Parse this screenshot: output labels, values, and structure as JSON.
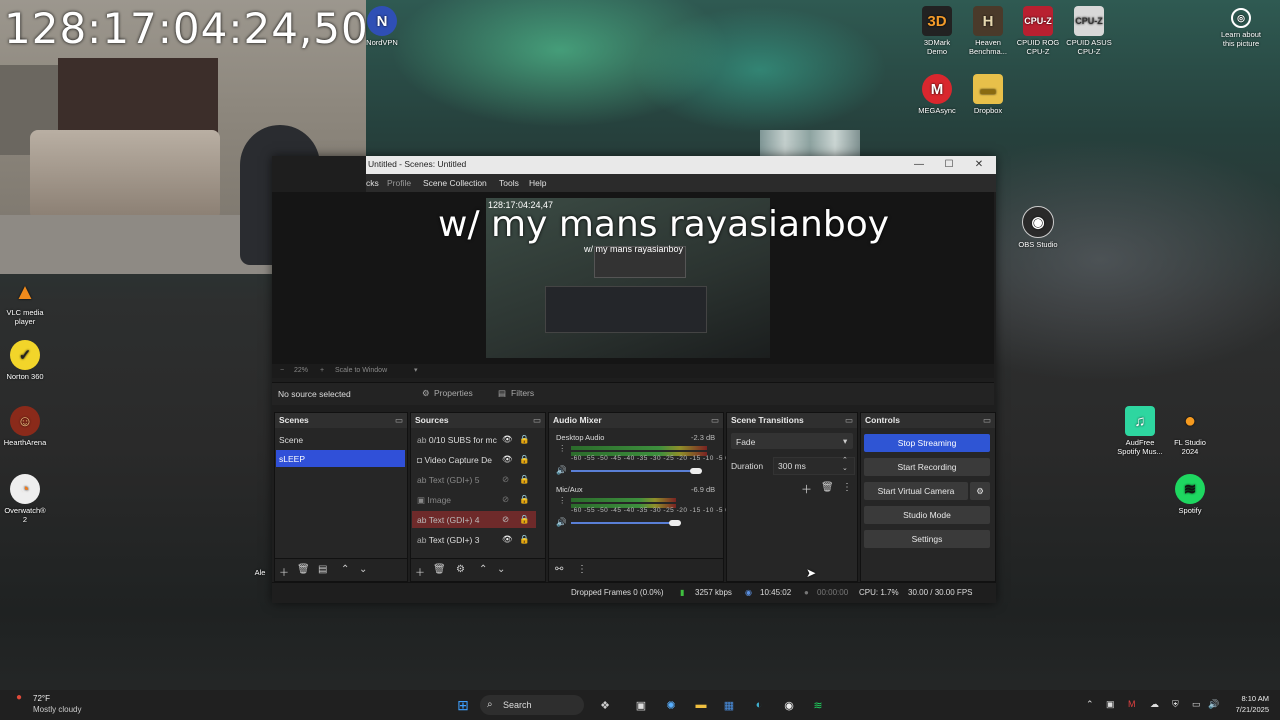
{
  "webcam": {
    "timecode": "128:17:04:24,50"
  },
  "desktop_icons": [
    {
      "label": "NordVPN"
    },
    {
      "label": "3DMark\nDemo"
    },
    {
      "label": "Heaven\nBenchma..."
    },
    {
      "label": "CPUID ROG\nCPU-Z"
    },
    {
      "label": "CPUID ASUS\nCPU-Z"
    },
    {
      "label": "Learn about\nthis picture"
    },
    {
      "label": "MEGAsync"
    },
    {
      "label": "Dropbox"
    },
    {
      "label": "OBS Studio"
    },
    {
      "label": "VLC media\nplayer"
    },
    {
      "label": "Norton 360"
    },
    {
      "label": "HearthArena"
    },
    {
      "label": "Overwatch®\n2"
    },
    {
      "label": "AudFree\nSpotify Mus..."
    },
    {
      "label": "FL Studio\n2024"
    },
    {
      "label": "Spotify"
    },
    {
      "label": "Ale"
    }
  ],
  "obs": {
    "title": "Untitled - Scenes: Untitled",
    "menu": [
      "cks",
      "Profile",
      "Scene Collection",
      "Tools",
      "Help"
    ],
    "preview": {
      "overlay_text": "w/ my mans rayasianboy",
      "inner_timecode": "128:17:04:24,47",
      "nested_title": "w/ my mans rayasianboy"
    },
    "zoom": {
      "minus": "−",
      "value": "22%",
      "plus": "+",
      "fit": "Scale to Window"
    },
    "source_toolbar": {
      "status": "No source selected",
      "properties": "Properties",
      "filters": "Filters"
    },
    "scenes": {
      "title": "Scenes",
      "items": [
        "Scene",
        "sLEEP"
      ]
    },
    "sources": {
      "title": "Sources",
      "items": [
        "0/10 SUBS for mc",
        "Video Capture De",
        "Text (GDI+) 5",
        "Image",
        "Text (GDI+) 4",
        "Text (GDI+) 3"
      ]
    },
    "mixer": {
      "title": "Audio Mixer",
      "channels": [
        {
          "name": "Desktop Audio",
          "db": "-2.3 dB",
          "scale": "-60 -55 -50 -45 -40 -35 -30 -25 -20 -15 -10 -5 0",
          "level": 0.93
        },
        {
          "name": "Mic/Aux",
          "db": "-6.9 dB",
          "scale": "-60 -55 -50 -45 -40 -35 -30 -25 -20 -15 -10 -5 0",
          "level": 0.72
        }
      ]
    },
    "transitions": {
      "title": "Scene Transitions",
      "type": "Fade",
      "duration_label": "Duration",
      "duration": "300 ms"
    },
    "controls": {
      "title": "Controls",
      "stop_streaming": "Stop Streaming",
      "start_recording": "Start Recording",
      "start_virtual_camera": "Start Virtual Camera",
      "studio_mode": "Studio Mode",
      "settings": "Settings"
    },
    "status": {
      "dropped": "Dropped Frames 0 (0.0%)",
      "kbps": "3257 kbps",
      "stream_time": "10:45:02",
      "rec_time": "00:00:00",
      "cpu": "CPU: 1.7%",
      "fps": "30.00 / 30.00 FPS"
    }
  },
  "taskbar": {
    "weather_temp": "72°F",
    "weather_desc": "Mostly cloudy",
    "search": "Search",
    "time": "8:10 AM",
    "date": "7/21/2025"
  },
  "colors": {
    "accent": "#3050d8",
    "active_source": "#6e2a2a",
    "stop_stream": "#2f55d4"
  }
}
